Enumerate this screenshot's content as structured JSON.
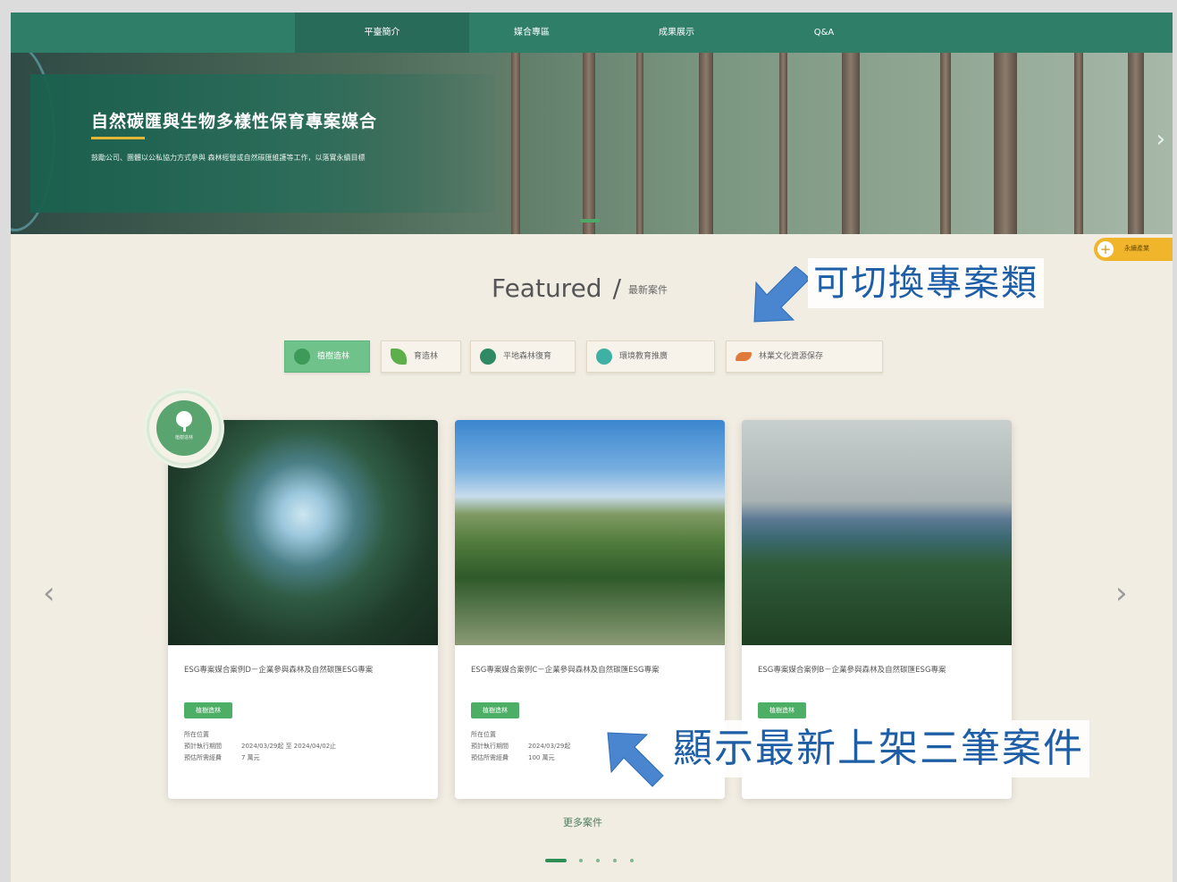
{
  "nav": {
    "items": [
      {
        "label": "平臺簡介",
        "active": true
      },
      {
        "label": "媒合專區",
        "active": false
      },
      {
        "label": "成果展示",
        "active": false
      },
      {
        "label": "Q&A",
        "active": false
      }
    ]
  },
  "hero": {
    "title": "自然碳匯與生物多樣性保育專案媒合",
    "description": "鼓勵公司、團體以公私協力方式參與 森林經營或自然碳匯維護等工作，以落實永續目標"
  },
  "float_button": {
    "label": "永續產業"
  },
  "featured": {
    "title": "Featured",
    "subtitle": "最新案件"
  },
  "category_tabs": [
    {
      "label": "植樹造林",
      "icon": "tree-icon",
      "active": true
    },
    {
      "label": "育造林",
      "icon": "sprout-icon",
      "active": false
    },
    {
      "label": "平地森林復育",
      "icon": "leaf-icon",
      "active": false
    },
    {
      "label": "環境教育推廣",
      "icon": "globe-icon",
      "active": false
    },
    {
      "label": "林業文化資源保存",
      "icon": "wood-icon",
      "active": false
    }
  ],
  "badge": {
    "label": "植樹造林",
    "icon": "tree-icon"
  },
  "cards": [
    {
      "title": "ESG專案媒合案例D－企業參與森林及自然碳匯ESG專案",
      "tag": "植樹造林",
      "location_label": "所在位置",
      "period_label": "預計執行期間",
      "period_value": "2024/03/29起 至 2024/04/02止",
      "budget_label": "預估所需經費",
      "budget_value": "7 萬元"
    },
    {
      "title": "ESG專案媒合案例C－企業參與森林及自然碳匯ESG專案",
      "tag": "植樹造林",
      "location_label": "所在位置",
      "period_label": "預計執行期間",
      "period_value": "2024/03/29起",
      "budget_label": "預估所需經費",
      "budget_value": "100 萬元"
    },
    {
      "title": "ESG專案媒合案例B－企業參與森林及自然碳匯ESG專案",
      "tag": "植樹造林",
      "location_label": "",
      "period_label": "",
      "period_value": "",
      "budget_label": "",
      "budget_value": ""
    }
  ],
  "more_link": "更多案件",
  "annotations": {
    "switch_categories": "可切換專案類",
    "latest_three": "顯示最新上架三筆案件"
  },
  "colors": {
    "primary_green": "#2e7e68",
    "tag_green": "#4caf65",
    "accent_yellow": "#f1b52c",
    "annotation_blue": "#1e5ea6",
    "background": "#f1ede3"
  }
}
